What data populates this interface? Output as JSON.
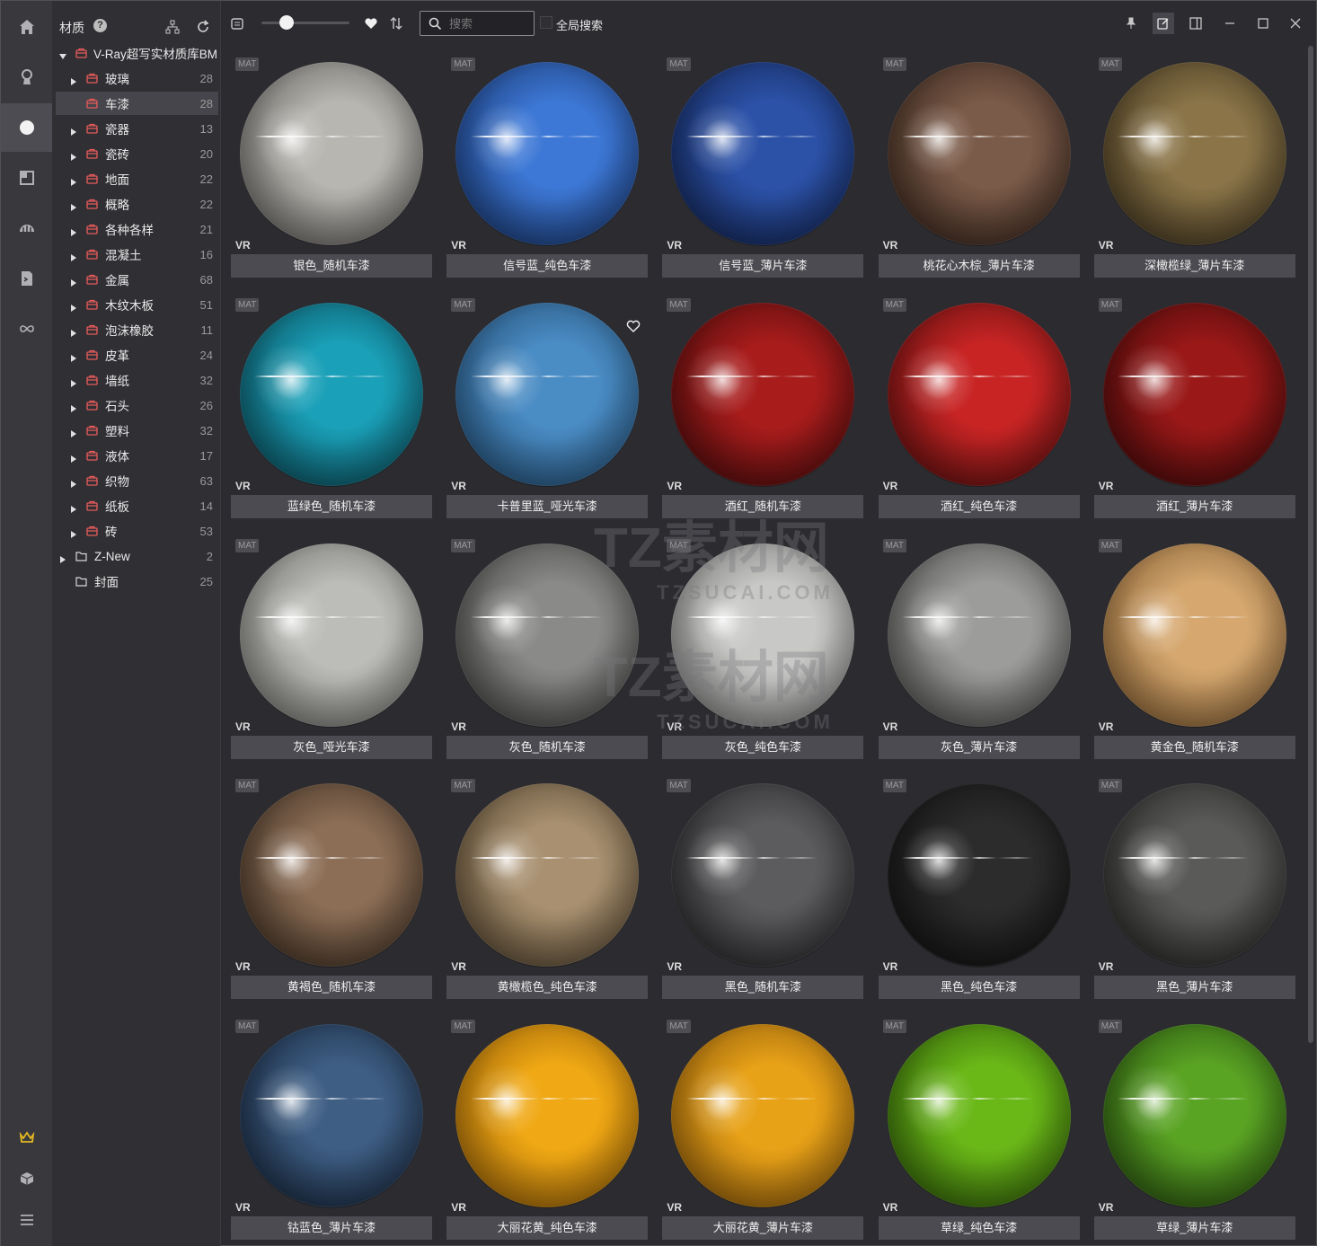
{
  "panel": {
    "title": "材质",
    "help": "?"
  },
  "tree": {
    "root": {
      "label": "V-Ray超写实材质库BM"
    },
    "items": [
      {
        "label": "玻璃",
        "count": "28"
      },
      {
        "label": "车漆",
        "count": "28",
        "selected": true
      },
      {
        "label": "瓷器",
        "count": "13"
      },
      {
        "label": "瓷砖",
        "count": "20"
      },
      {
        "label": "地面",
        "count": "22"
      },
      {
        "label": "概略",
        "count": "22"
      },
      {
        "label": "各种各样",
        "count": "21"
      },
      {
        "label": "混凝土",
        "count": "16"
      },
      {
        "label": "金属",
        "count": "68"
      },
      {
        "label": "木纹木板",
        "count": "51"
      },
      {
        "label": "泡沫橡胶",
        "count": "11"
      },
      {
        "label": "皮革",
        "count": "24"
      },
      {
        "label": "墙纸",
        "count": "32"
      },
      {
        "label": "石头",
        "count": "26"
      },
      {
        "label": "塑料",
        "count": "32"
      },
      {
        "label": "液体",
        "count": "17"
      },
      {
        "label": "织物",
        "count": "63"
      },
      {
        "label": "纸板",
        "count": "14"
      },
      {
        "label": "砖",
        "count": "53"
      }
    ],
    "folders": [
      {
        "label": "Z-New",
        "count": "2"
      },
      {
        "label": "封面",
        "count": "25"
      }
    ]
  },
  "toolbar": {
    "search_placeholder": "搜索",
    "global_search_label": "全局搜索",
    "zoom_level": 0.2
  },
  "grid": {
    "badge": "MAT",
    "renderer": "VR",
    "items": [
      {
        "name": "银色_随机车漆",
        "color": "#b8b6b1",
        "dark": "#4a4845"
      },
      {
        "name": "信号蓝_纯色车漆",
        "color": "#3d78d6",
        "dark": "#0e2450"
      },
      {
        "name": "信号蓝_薄片车漆",
        "color": "#2c52a8",
        "dark": "#0a1638"
      },
      {
        "name": "桃花心木棕_薄片车漆",
        "color": "#7a5a48",
        "dark": "#241610"
      },
      {
        "name": "深橄榄绿_薄片车漆",
        "color": "#8a7448",
        "dark": "#2a2212"
      },
      {
        "name": "蓝绿色_随机车漆",
        "color": "#1aa0b8",
        "dark": "#06323c"
      },
      {
        "name": "卡普里蓝_哑光车漆",
        "color": "#4a8cc4",
        "dark": "#173a5a",
        "favorite": true
      },
      {
        "name": "酒红_随机车漆",
        "color": "#a81c1c",
        "dark": "#300606"
      },
      {
        "name": "酒红_纯色车漆",
        "color": "#c82424",
        "dark": "#3a0808"
      },
      {
        "name": "酒红_薄片车漆",
        "color": "#9a1818",
        "dark": "#2a0505"
      },
      {
        "name": "灰色_哑光车漆",
        "color": "#bcbcb8",
        "dark": "#5a5a57"
      },
      {
        "name": "灰色_随机车漆",
        "color": "#8a8a88",
        "dark": "#2c2c2b"
      },
      {
        "name": "灰色_纯色车漆",
        "color": "#c8c8c6",
        "dark": "#5e5e5c"
      },
      {
        "name": "灰色_薄片车漆",
        "color": "#9c9c9a",
        "dark": "#333332"
      },
      {
        "name": "黄金色_随机车漆",
        "color": "#d6a870",
        "dark": "#6a4820"
      },
      {
        "name": "黄褐色_随机车漆",
        "color": "#8c6e56",
        "dark": "#2a1e14"
      },
      {
        "name": "黄橄榄色_纯色车漆",
        "color": "#a89070",
        "dark": "#3a2e1c"
      },
      {
        "name": "黑色_随机车漆",
        "color": "#5c5c5e",
        "dark": "#151517"
      },
      {
        "name": "黑色_纯色车漆",
        "color": "#2c2c2c",
        "dark": "#080808"
      },
      {
        "name": "黑色_薄片车漆",
        "color": "#5a5a58",
        "dark": "#161615"
      },
      {
        "name": "钴蓝色_薄片车漆",
        "color": "#3e5e84",
        "dark": "#0c1626"
      },
      {
        "name": "大丽花黄_纯色车漆",
        "color": "#f0a814",
        "dark": "#7a4a04"
      },
      {
        "name": "大丽花黄_薄片车漆",
        "color": "#e8a218",
        "dark": "#704406"
      },
      {
        "name": "草绿_纯色车漆",
        "color": "#6ab818",
        "dark": "#1e3e04"
      },
      {
        "name": "草绿_薄片车漆",
        "color": "#5aa424",
        "dark": "#183408"
      }
    ]
  },
  "watermark": {
    "text": "TZ素材网",
    "sub": "TZSUCAI.COM"
  }
}
